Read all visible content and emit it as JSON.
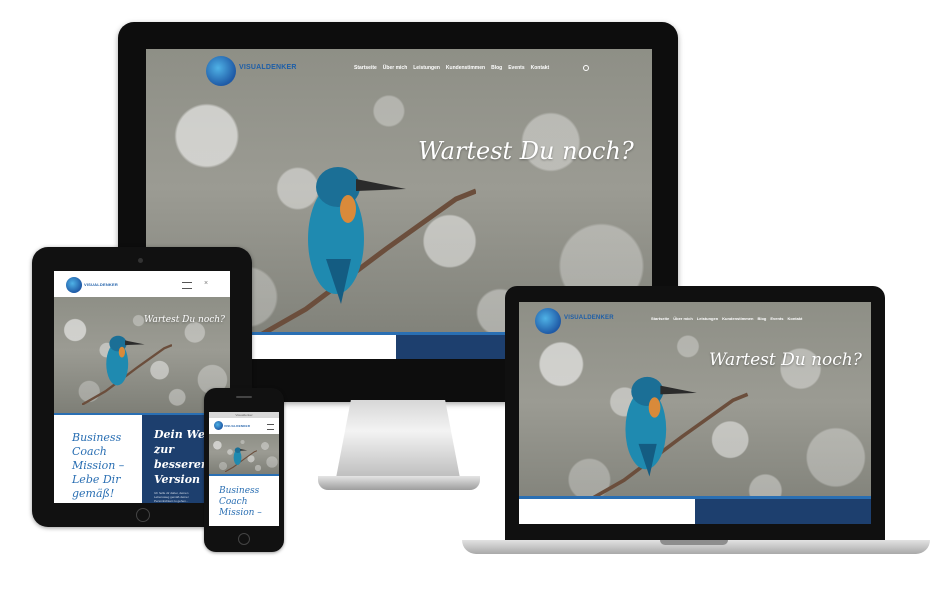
{
  "brand": {
    "logo_text": "VISUALDENKER"
  },
  "nav": [
    "Startseite",
    "Über mich",
    "Leistungen",
    "Kundenstimmen",
    "Blog",
    "Events",
    "Kontakt"
  ],
  "hero": {
    "headline": "Wartest Du noch?"
  },
  "tablet": {
    "left_text": [
      "Business",
      "Coach",
      "Mission –",
      "Lebe Dir",
      "gemäß!"
    ],
    "right_text": [
      "Dein Weg",
      "zur",
      "besseren",
      "Version"
    ],
    "small_text": [
      "Ich helfe dir dabei, deinen",
      "Lebensweg gemäß deiner",
      "Persönlichkeit zu gehen..."
    ]
  },
  "phone": {
    "top_bar": "Visualdenker",
    "left_text": [
      "Business",
      "Coach",
      "Mission –"
    ]
  },
  "colors": {
    "navy": "#1d3f6e",
    "accent_blue": "#2a6fb3",
    "logo_blue": "#1d5ea8"
  }
}
